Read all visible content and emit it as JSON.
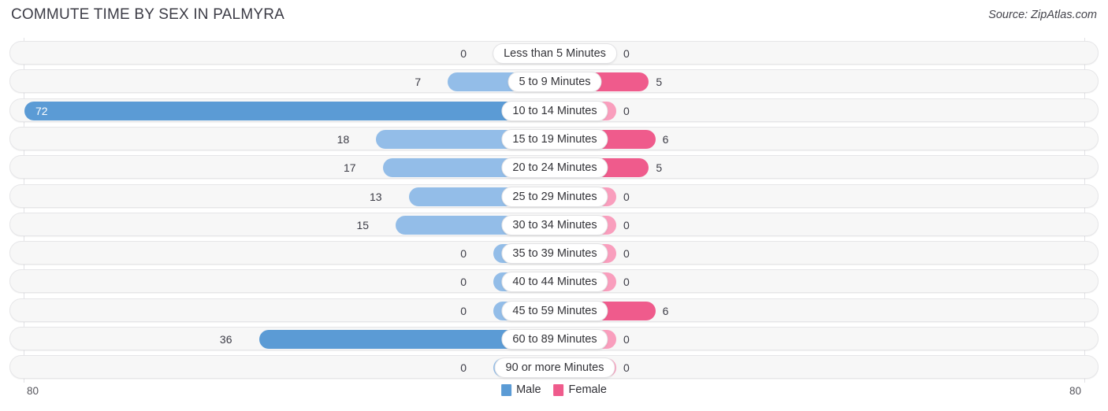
{
  "header": {
    "title": "COMMUTE TIME BY SEX IN PALMYRA",
    "source": "Source: ZipAtlas.com"
  },
  "axis": {
    "left_label": "80",
    "right_label": "80"
  },
  "legend": {
    "items": [
      {
        "label": "Male",
        "color": "#5b9bd5"
      },
      {
        "label": "Female",
        "color": "#ef5b8c"
      }
    ]
  },
  "chart_data": {
    "type": "bar",
    "title": "COMMUTE TIME BY SEX IN PALMYRA",
    "subtitle": "Source: ZipAtlas.com",
    "orientation": "horizontal-diverging",
    "xlabel": "",
    "ylabel": "",
    "xlim": [
      80,
      80
    ],
    "axis_max_left": 80,
    "axis_max_right": 80,
    "grid": true,
    "legend_position": "bottom-center",
    "categories": [
      "Less than 5 Minutes",
      "5 to 9 Minutes",
      "10 to 14 Minutes",
      "15 to 19 Minutes",
      "20 to 24 Minutes",
      "25 to 29 Minutes",
      "30 to 34 Minutes",
      "35 to 39 Minutes",
      "40 to 44 Minutes",
      "45 to 59 Minutes",
      "60 to 89 Minutes",
      "90 or more Minutes"
    ],
    "series": [
      {
        "name": "Male",
        "color": "#5b9bd5",
        "values": [
          0,
          7,
          72,
          18,
          17,
          13,
          15,
          0,
          0,
          0,
          36,
          0
        ]
      },
      {
        "name": "Female",
        "color": "#ef5b8c",
        "values": [
          0,
          5,
          0,
          6,
          5,
          0,
          0,
          0,
          0,
          6,
          0,
          0
        ]
      }
    ]
  }
}
